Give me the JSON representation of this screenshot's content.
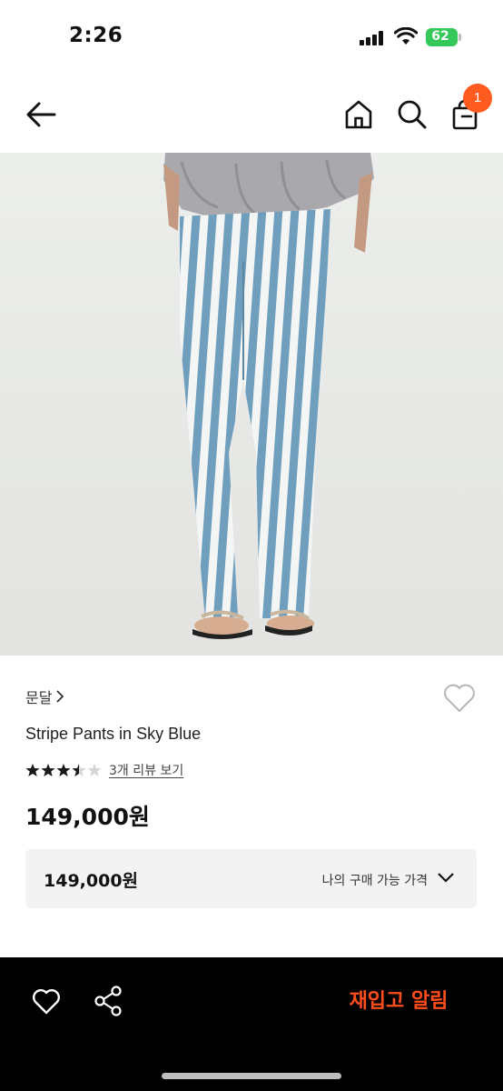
{
  "status_bar": {
    "time": "2:26",
    "battery_level": "62",
    "battery_color": "#34c759",
    "icons": [
      "signal-icon",
      "wifi-icon",
      "battery-icon"
    ]
  },
  "header": {
    "icons": [
      "back-arrow-icon",
      "home-icon",
      "search-icon",
      "shopping-bag-icon"
    ],
    "cart_count": "1",
    "badge_color": "#ff5a1f"
  },
  "product": {
    "image_description_icon": "product-photo",
    "brand": "문달",
    "title": "Stripe Pants in Sky Blue",
    "rating": 3.5,
    "rating_max": 5,
    "review_link": "3개 리뷰 보기",
    "price": "149,000원",
    "my_price": {
      "value": "149,000원",
      "label": "나의 구매 가능 가격"
    }
  },
  "bottom_bar": {
    "icons": [
      "heart-icon",
      "share-icon"
    ],
    "restock_label": "재입고 알림",
    "restock_color": "#ff4d1c"
  }
}
